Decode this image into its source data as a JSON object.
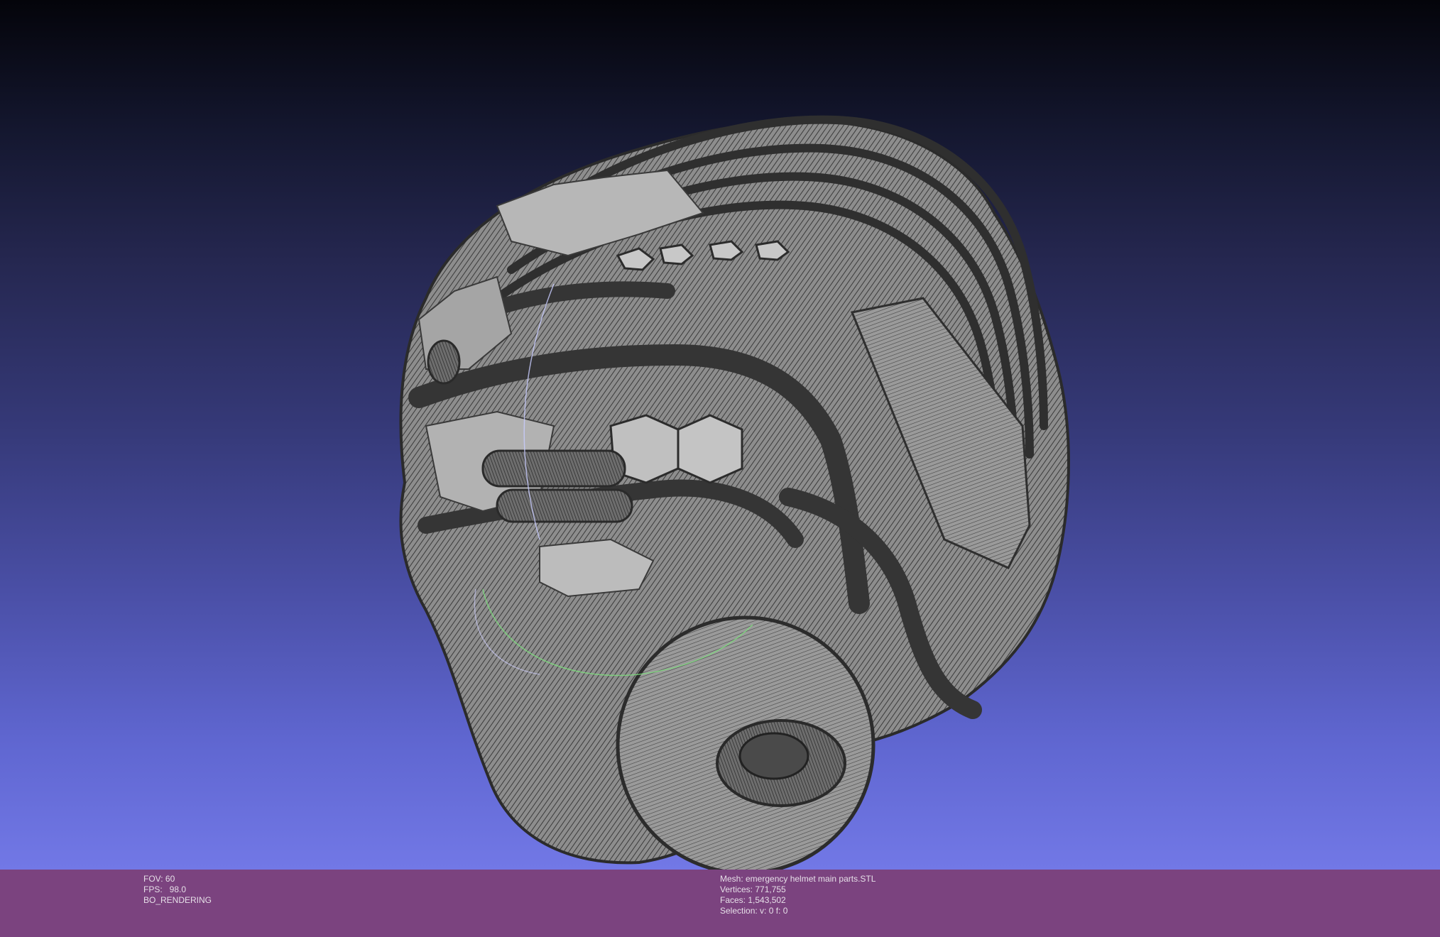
{
  "render_info": {
    "fov": "FOV: 60",
    "fps": "FPS:   98.0",
    "mode": "BO_RENDERING"
  },
  "mesh_info": {
    "mesh": "Mesh: emergency helmet main parts.STL",
    "vertices": "Vertices: 771,755",
    "faces": "Faces: 1,543,502",
    "selection": "Selection: v: 0 f: 0"
  },
  "colors": {
    "background_top": "#04040a",
    "background_bottom": "#7278e6",
    "status_bar": "#7b437f",
    "mesh_fill": "#a8a8a8",
    "mesh_wire": "#3a3a3a",
    "trackball_x": "#c8ccff",
    "trackball_y": "#7de07d"
  },
  "icons": {
    "trackball": "trackball-gizmo"
  }
}
